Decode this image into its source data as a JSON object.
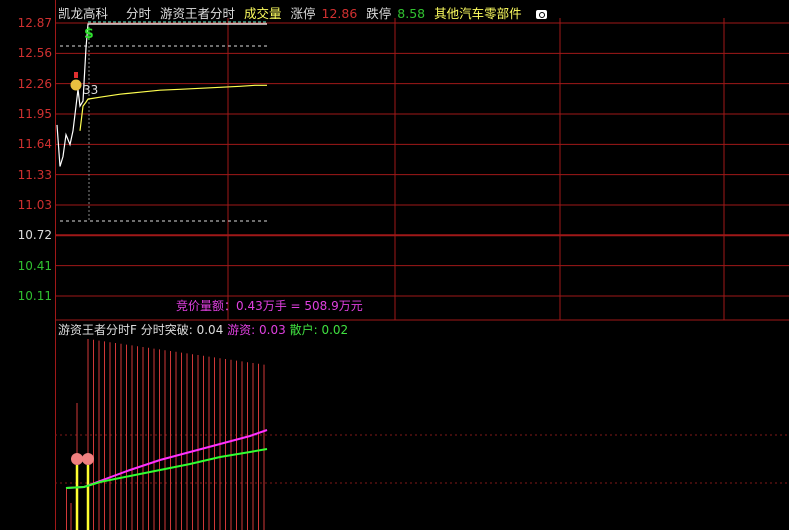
{
  "header": {
    "stock_name": "凯龙高科",
    "mode": "分时",
    "indicator": "游资王者分时",
    "volume_label": "成交量",
    "limit_up_label": "涨停",
    "limit_up_value": "12.86",
    "limit_down_label": "跌停",
    "limit_down_value": "8.58",
    "sector": "其他汽车零部件",
    "camera_icon": "camera-icon"
  },
  "price_axis": {
    "ticks": [
      "12.87",
      "12.56",
      "12.26",
      "11.95",
      "11.64",
      "11.33",
      "11.03",
      "10.72",
      "10.41",
      "10.11"
    ],
    "prev_close": "10.72",
    "up_color": "#d03030",
    "down_color": "#30c030"
  },
  "annotations": {
    "marker_label": "33",
    "buy_icon": "money-bag-icon",
    "dollar_icon": "dollar-sign-icon"
  },
  "auction": {
    "text": "竞价量额：0.43万手 = 508.9万元"
  },
  "lower_panel": {
    "title": "游资王者分时F",
    "breakout_label": "分时突破:",
    "breakout_value": "0.04",
    "hot_money_label": "游资:",
    "hot_money_value": "0.03",
    "retail_label": "散户:",
    "retail_value": "0.02",
    "hot_money_color": "#ff30ff",
    "retail_color": "#30ff30"
  },
  "series": {
    "price": [
      11.84,
      11.42,
      11.52,
      11.74,
      11.64,
      11.78,
      12.03,
      12.2,
      12.03,
      12.08,
      12.62,
      12.86,
      12.86,
      12.86,
      12.86,
      12.86,
      12.86,
      12.86,
      12.86,
      12.86,
      12.86,
      12.86,
      12.86
    ],
    "avg_price": [
      null,
      null,
      null,
      null,
      null,
      null,
      null,
      null,
      11.78,
      12.03,
      12.07,
      12.1,
      12.12,
      12.15,
      12.17,
      12.19,
      12.2,
      12.21,
      12.22,
      12.23,
      12.24,
      12.24,
      12.24
    ]
  }
}
